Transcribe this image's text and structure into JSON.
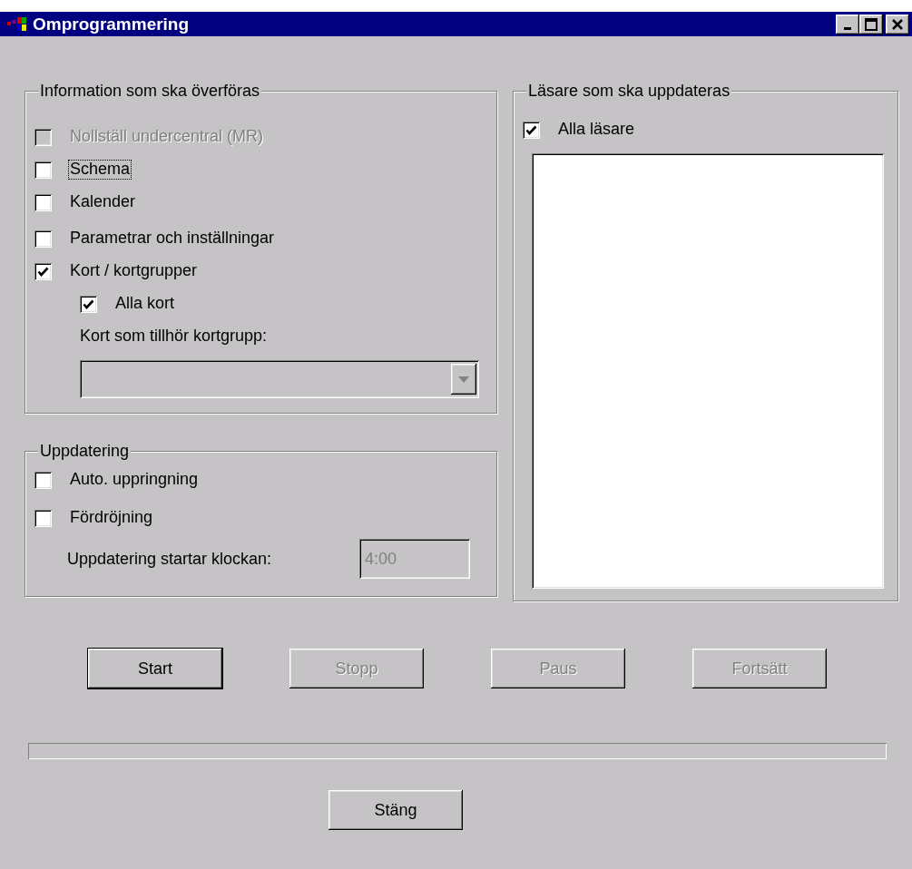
{
  "window": {
    "title": "Omprogrammering"
  },
  "info_group": {
    "title": "Information som ska överföras",
    "options": [
      {
        "label": "Nollställ undercentral (MR)",
        "checked": false,
        "disabled": true,
        "focused": false
      },
      {
        "label": "Schema",
        "checked": false,
        "disabled": false,
        "focused": true
      },
      {
        "label": "Kalender",
        "checked": false,
        "disabled": false,
        "focused": false
      },
      {
        "label": "Parametrar och inställningar",
        "checked": false,
        "disabled": false,
        "focused": false
      },
      {
        "label": "Kort / kortgrupper",
        "checked": true,
        "disabled": false,
        "focused": false,
        "children": [
          {
            "label": "Alla kort",
            "checked": true,
            "disabled": false,
            "focused": false
          }
        ]
      }
    ],
    "group_label": "Kort som tillhör kortgrupp:",
    "group_select": {
      "disabled": true
    }
  },
  "update_group": {
    "title": "Uppdatering",
    "options": [
      {
        "label": "Auto. uppringning",
        "checked": false,
        "disabled": false,
        "focused": false
      },
      {
        "label": "Fördröjning",
        "checked": false,
        "disabled": false,
        "focused": false
      }
    ],
    "start_label": "Uppdatering startar klockan:",
    "start_time": {
      "value": "4:00",
      "disabled": true
    }
  },
  "readers_group": {
    "title": "Läsare som ska uppdateras",
    "all_option": {
      "label": "Alla läsare",
      "checked": true,
      "disabled": false,
      "focused": false
    }
  },
  "buttons": [
    {
      "label": "Start",
      "disabled": false,
      "default": true
    },
    {
      "label": "Stopp",
      "disabled": true,
      "default": false
    },
    {
      "label": "Paus",
      "disabled": true,
      "default": false
    },
    {
      "label": "Fortsätt",
      "disabled": true,
      "default": false
    }
  ],
  "progress": {
    "level": 0
  },
  "close_button": {
    "label": "Stäng",
    "disabled": false,
    "default": false
  }
}
